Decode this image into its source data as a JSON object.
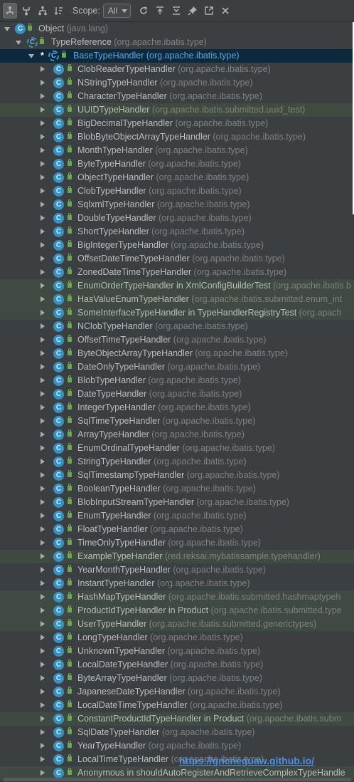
{
  "toolbar": {
    "scope_label": "Scope:",
    "scope_value": "All",
    "buttons": [
      {
        "name": "supertypes-hierarchy-icon",
        "active": true
      },
      {
        "name": "subtypes-hierarchy-icon",
        "active": false
      },
      {
        "name": "class-hierarchy-icon",
        "active": false
      },
      {
        "name": "sort-alphabetically-icon",
        "active": false
      }
    ],
    "right_buttons": [
      {
        "name": "refresh-icon"
      },
      {
        "name": "autoscroll-to-source-icon"
      },
      {
        "name": "collapse-all-icon"
      },
      {
        "name": "pin-icon"
      },
      {
        "name": "open-in-editor-icon"
      },
      {
        "name": "close-icon"
      }
    ]
  },
  "tree": {
    "root": {
      "name": "Object",
      "pkg": "(java.lang)"
    },
    "parent": {
      "name": "TypeReference",
      "pkg": "(org.apache.ibatis.type)"
    },
    "selected": {
      "marker": "*",
      "name": "BaseTypeHandler",
      "pkg": "(org.apache.ibatis.type)"
    },
    "children": [
      {
        "name": "ClobReaderTypeHandler",
        "pkg": "(org.apache.ibatis.type)",
        "hl": false
      },
      {
        "name": "NStringTypeHandler",
        "pkg": "(org.apache.ibatis.type)",
        "hl": false
      },
      {
        "name": "CharacterTypeHandler",
        "pkg": "(org.apache.ibatis.type)",
        "hl": false
      },
      {
        "name": "UUIDTypeHandler",
        "pkg": "(org.apache.ibatis.submitted.uuid_test)",
        "hl": true
      },
      {
        "name": "BigDecimalTypeHandler",
        "pkg": "(org.apache.ibatis.type)",
        "hl": false
      },
      {
        "name": "BlobByteObjectArrayTypeHandler",
        "pkg": "(org.apache.ibatis.type)",
        "hl": false
      },
      {
        "name": "MonthTypeHandler",
        "pkg": "(org.apache.ibatis.type)",
        "hl": false
      },
      {
        "name": "ByteTypeHandler",
        "pkg": "(org.apache.ibatis.type)",
        "hl": false
      },
      {
        "name": "ObjectTypeHandler",
        "pkg": "(org.apache.ibatis.type)",
        "hl": false
      },
      {
        "name": "ClobTypeHandler",
        "pkg": "(org.apache.ibatis.type)",
        "hl": false
      },
      {
        "name": "SqlxmlTypeHandler",
        "pkg": "(org.apache.ibatis.type)",
        "hl": false
      },
      {
        "name": "DoubleTypeHandler",
        "pkg": "(org.apache.ibatis.type)",
        "hl": false
      },
      {
        "name": "ShortTypeHandler",
        "pkg": "(org.apache.ibatis.type)",
        "hl": false
      },
      {
        "name": "BigIntegerTypeHandler",
        "pkg": "(org.apache.ibatis.type)",
        "hl": false
      },
      {
        "name": "OffsetDateTimeTypeHandler",
        "pkg": "(org.apache.ibatis.type)",
        "hl": false
      },
      {
        "name": "ZonedDateTimeTypeHandler",
        "pkg": "(org.apache.ibatis.type)",
        "hl": false
      },
      {
        "name": "EnumOrderTypeHandler in XmlConfigBuilderTest",
        "pkg": "(org.apache.ibatis.b",
        "hl": true
      },
      {
        "name": "HasValueEnumTypeHandler",
        "pkg": "(org.apache.ibatis.submitted.enum_int",
        "hl": true
      },
      {
        "name": "SomeInterfaceTypeHandler in TypeHandlerRegistryTest",
        "pkg": "(org.apach",
        "hl": true
      },
      {
        "name": "NClobTypeHandler",
        "pkg": "(org.apache.ibatis.type)",
        "hl": false
      },
      {
        "name": "OffsetTimeTypeHandler",
        "pkg": "(org.apache.ibatis.type)",
        "hl": false
      },
      {
        "name": "ByteObjectArrayTypeHandler",
        "pkg": "(org.apache.ibatis.type)",
        "hl": false
      },
      {
        "name": "DateOnlyTypeHandler",
        "pkg": "(org.apache.ibatis.type)",
        "hl": false
      },
      {
        "name": "BlobTypeHandler",
        "pkg": "(org.apache.ibatis.type)",
        "hl": false
      },
      {
        "name": "DateTypeHandler",
        "pkg": "(org.apache.ibatis.type)",
        "hl": false
      },
      {
        "name": "IntegerTypeHandler",
        "pkg": "(org.apache.ibatis.type)",
        "hl": false
      },
      {
        "name": "SqlTimeTypeHandler",
        "pkg": "(org.apache.ibatis.type)",
        "hl": false
      },
      {
        "name": "ArrayTypeHandler",
        "pkg": "(org.apache.ibatis.type)",
        "hl": false
      },
      {
        "name": "EnumOrdinalTypeHandler",
        "pkg": "(org.apache.ibatis.type)",
        "hl": false
      },
      {
        "name": "StringTypeHandler",
        "pkg": "(org.apache.ibatis.type)",
        "hl": false
      },
      {
        "name": "SqlTimestampTypeHandler",
        "pkg": "(org.apache.ibatis.type)",
        "hl": false
      },
      {
        "name": "BooleanTypeHandler",
        "pkg": "(org.apache.ibatis.type)",
        "hl": false
      },
      {
        "name": "BlobInputStreamTypeHandler",
        "pkg": "(org.apache.ibatis.type)",
        "hl": false
      },
      {
        "name": "EnumTypeHandler",
        "pkg": "(org.apache.ibatis.type)",
        "hl": false
      },
      {
        "name": "FloatTypeHandler",
        "pkg": "(org.apache.ibatis.type)",
        "hl": false
      },
      {
        "name": "TimeOnlyTypeHandler",
        "pkg": "(org.apache.ibatis.type)",
        "hl": false
      },
      {
        "name": "ExampleTypeHandler",
        "pkg": "(red.reksai.mybatissample.typehandler)",
        "hl": true
      },
      {
        "name": "YearMonthTypeHandler",
        "pkg": "(org.apache.ibatis.type)",
        "hl": false
      },
      {
        "name": "InstantTypeHandler",
        "pkg": "(org.apache.ibatis.type)",
        "hl": false
      },
      {
        "name": "HashMapTypeHandler",
        "pkg": "(org.apache.ibatis.submitted.hashmaptypeh",
        "hl": true
      },
      {
        "name": "ProductIdTypeHandler in Product",
        "pkg": "(org.apache.ibatis.submitted.type",
        "hl": true
      },
      {
        "name": "UserTypeHandler",
        "pkg": "(org.apache.ibatis.submitted.generictypes)",
        "hl": true
      },
      {
        "name": "LongTypeHandler",
        "pkg": "(org.apache.ibatis.type)",
        "hl": false
      },
      {
        "name": "UnknownTypeHandler",
        "pkg": "(org.apache.ibatis.type)",
        "hl": false
      },
      {
        "name": "LocalDateTypeHandler",
        "pkg": "(org.apache.ibatis.type)",
        "hl": false
      },
      {
        "name": "ByteArrayTypeHandler",
        "pkg": "(org.apache.ibatis.type)",
        "hl": false
      },
      {
        "name": "JapaneseDateTypeHandler",
        "pkg": "(org.apache.ibatis.type)",
        "hl": false
      },
      {
        "name": "LocalDateTimeTypeHandler",
        "pkg": "(org.apache.ibatis.type)",
        "hl": false
      },
      {
        "name": "ConstantProductIdTypeHandler in Product",
        "pkg": "(org.apache.ibatis.subm",
        "hl": true
      },
      {
        "name": "SqlDateTypeHandler",
        "pkg": "(org.apache.ibatis.type)",
        "hl": false
      },
      {
        "name": "YearTypeHandler",
        "pkg": "(org.apache.ibatis.type)",
        "hl": false
      },
      {
        "name": "LocalTimeTypeHandler",
        "pkg": "(org.apache.ibatis.type)",
        "hl": false
      },
      {
        "name": "Anonymous in shouldAutoRegisterAndRetrieveComplexTypeHandle",
        "pkg": "",
        "hl": true
      }
    ]
  },
  "watermark": "https://gncneguaw.github.io/",
  "colors": {
    "background": "#3c3f41",
    "selection": "#0d293e",
    "highlight_row": "#3f4b42",
    "class_icon": "#3592c4",
    "lock": "#6aa84f"
  }
}
